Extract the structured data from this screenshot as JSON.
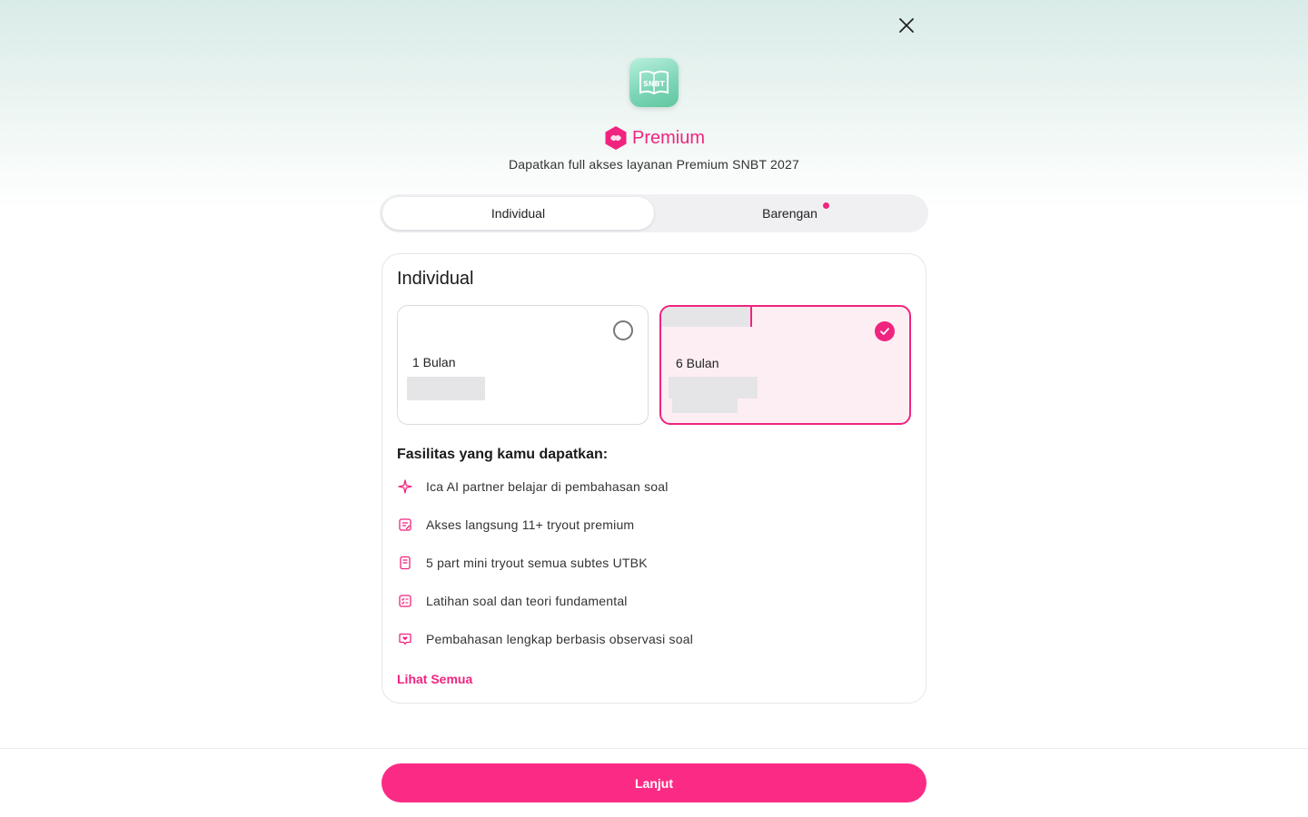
{
  "header": {
    "close_icon": "close-icon",
    "app_logo_text": "SNBT",
    "badge_icon": "premium-hexagon-icon",
    "title": "Premium",
    "subtitle": "Dapatkan full akses layanan Premium SNBT 2027"
  },
  "tabs": [
    {
      "label": "Individual",
      "active": true
    },
    {
      "label": "Barengan",
      "active": false,
      "has_dot": true
    }
  ],
  "card": {
    "title": "Individual",
    "plans": [
      {
        "name": "1 Bulan",
        "selected": false
      },
      {
        "name": "6 Bulan",
        "selected": true
      }
    ],
    "facilities_title": "Fasilitas yang kamu dapatkan:",
    "features": [
      {
        "icon": "sparkle-icon",
        "label": "Ica AI partner belajar di pembahasan soal"
      },
      {
        "icon": "note-edit-icon",
        "label": "Akses langsung 11+ tryout premium"
      },
      {
        "icon": "document-icon",
        "label": "5 part mini tryout semua subtes UTBK"
      },
      {
        "icon": "checklist-icon",
        "label": "Latihan soal dan teori fundamental"
      },
      {
        "icon": "chat-heart-icon",
        "label": "Pembahasan lengkap berbasis observasi soal"
      }
    ],
    "see_all": "Lihat Semua"
  },
  "footer": {
    "cta_label": "Lanjut"
  },
  "colors": {
    "accent": "#f0247f",
    "cta": "#fb2b85",
    "selected_bg": "#fdeef4"
  }
}
